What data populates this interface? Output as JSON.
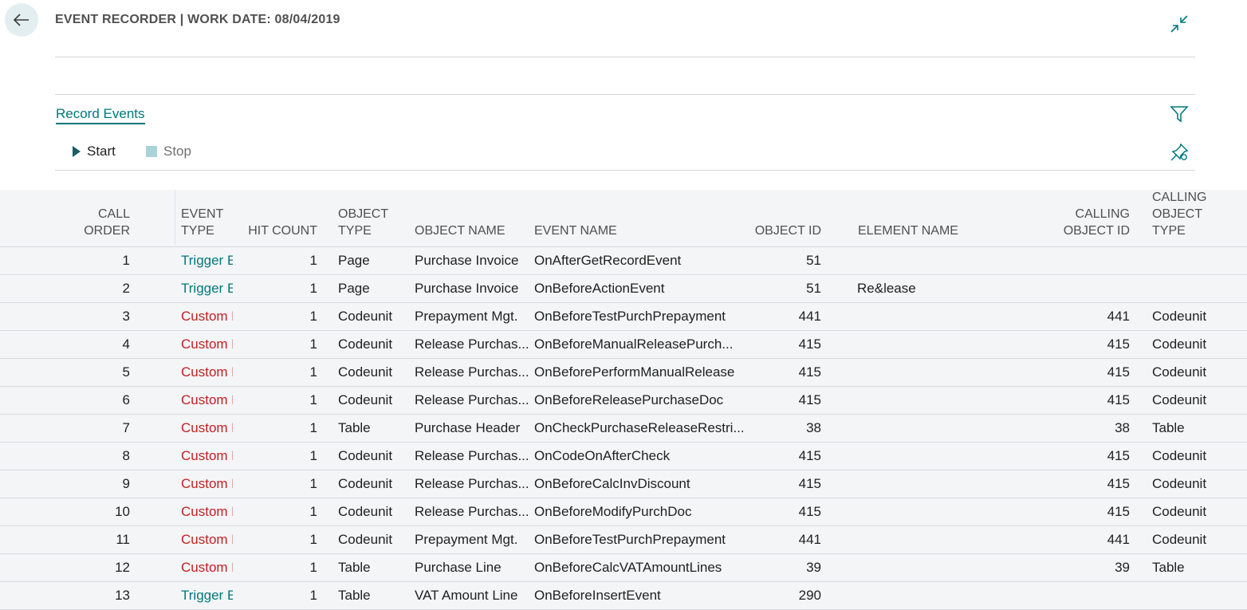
{
  "header": {
    "title": "EVENT RECORDER | WORK DATE: 08/04/2019"
  },
  "tabs": {
    "record_events": "Record Events"
  },
  "actions": {
    "start": "Start",
    "stop": "Stop"
  },
  "colors": {
    "accent": "#00797c",
    "custom_event": "#c42020",
    "row_bg": "#f4f5f7"
  },
  "icons": [
    "back-arrow-icon",
    "collapse-icon",
    "filter-icon",
    "pin-icon",
    "play-icon",
    "stop-icon"
  ],
  "columns": {
    "call_order": "CALL ORDER",
    "event_type": "EVENT TYPE",
    "hit_count": "HIT COUNT",
    "object_type": "OBJECT TYPE",
    "object_name": "OBJECT NAME",
    "event_name": "EVENT NAME",
    "object_id": "OBJECT ID",
    "element_name": "ELEMENT NAME",
    "calling_object_id": "CALLING OBJECT ID",
    "calling_object_type": "CALLING OBJECT TYPE"
  },
  "rows": [
    {
      "order": "1",
      "etype": "Trigger Event",
      "kind": "trigger",
      "hit": "1",
      "otype": "Page",
      "oname": "Purchase Invoice",
      "ename": "OnAfterGetRecordEvent",
      "oid": "51",
      "elname": "",
      "coid": "",
      "cotype": ""
    },
    {
      "order": "2",
      "etype": "Trigger Event",
      "kind": "trigger",
      "hit": "1",
      "otype": "Page",
      "oname": "Purchase Invoice",
      "ename": "OnBeforeActionEvent",
      "oid": "51",
      "elname": "Re&lease",
      "coid": "",
      "cotype": ""
    },
    {
      "order": "3",
      "etype": "Custom Eve...",
      "kind": "custom",
      "hit": "1",
      "otype": "Codeunit",
      "oname": "Prepayment Mgt.",
      "ename": "OnBeforeTestPurchPrepayment",
      "oid": "441",
      "elname": "",
      "coid": "441",
      "cotype": "Codeunit"
    },
    {
      "order": "4",
      "etype": "Custom Eve...",
      "kind": "custom",
      "hit": "1",
      "otype": "Codeunit",
      "oname": "Release Purchas...",
      "ename": "OnBeforeManualReleasePurch...",
      "oid": "415",
      "elname": "",
      "coid": "415",
      "cotype": "Codeunit"
    },
    {
      "order": "5",
      "etype": "Custom Eve...",
      "kind": "custom",
      "hit": "1",
      "otype": "Codeunit",
      "oname": "Release Purchas...",
      "ename": "OnBeforePerformManualRelease",
      "oid": "415",
      "elname": "",
      "coid": "415",
      "cotype": "Codeunit"
    },
    {
      "order": "6",
      "etype": "Custom Eve...",
      "kind": "custom",
      "hit": "1",
      "otype": "Codeunit",
      "oname": "Release Purchas...",
      "ename": "OnBeforeReleasePurchaseDoc",
      "oid": "415",
      "elname": "",
      "coid": "415",
      "cotype": "Codeunit"
    },
    {
      "order": "7",
      "etype": "Custom Eve...",
      "kind": "custom",
      "hit": "1",
      "otype": "Table",
      "oname": "Purchase Header",
      "ename": "OnCheckPurchaseReleaseRestri...",
      "oid": "38",
      "elname": "",
      "coid": "38",
      "cotype": "Table"
    },
    {
      "order": "8",
      "etype": "Custom Eve...",
      "kind": "custom",
      "hit": "1",
      "otype": "Codeunit",
      "oname": "Release Purchas...",
      "ename": "OnCodeOnAfterCheck",
      "oid": "415",
      "elname": "",
      "coid": "415",
      "cotype": "Codeunit"
    },
    {
      "order": "9",
      "etype": "Custom Eve...",
      "kind": "custom",
      "hit": "1",
      "otype": "Codeunit",
      "oname": "Release Purchas...",
      "ename": "OnBeforeCalcInvDiscount",
      "oid": "415",
      "elname": "",
      "coid": "415",
      "cotype": "Codeunit"
    },
    {
      "order": "10",
      "etype": "Custom Eve...",
      "kind": "custom",
      "hit": "1",
      "otype": "Codeunit",
      "oname": "Release Purchas...",
      "ename": "OnBeforeModifyPurchDoc",
      "oid": "415",
      "elname": "",
      "coid": "415",
      "cotype": "Codeunit"
    },
    {
      "order": "11",
      "etype": "Custom Eve...",
      "kind": "custom",
      "hit": "1",
      "otype": "Codeunit",
      "oname": "Prepayment Mgt.",
      "ename": "OnBeforeTestPurchPrepayment",
      "oid": "441",
      "elname": "",
      "coid": "441",
      "cotype": "Codeunit"
    },
    {
      "order": "12",
      "etype": "Custom Eve...",
      "kind": "custom",
      "hit": "1",
      "otype": "Table",
      "oname": "Purchase Line",
      "ename": "OnBeforeCalcVATAmountLines",
      "oid": "39",
      "elname": "",
      "coid": "39",
      "cotype": "Table"
    },
    {
      "order": "13",
      "etype": "Trigger Event",
      "kind": "trigger",
      "hit": "1",
      "otype": "Table",
      "oname": "VAT Amount Line",
      "ename": "OnBeforeInsertEvent",
      "oid": "290",
      "elname": "",
      "coid": "",
      "cotype": ""
    }
  ]
}
